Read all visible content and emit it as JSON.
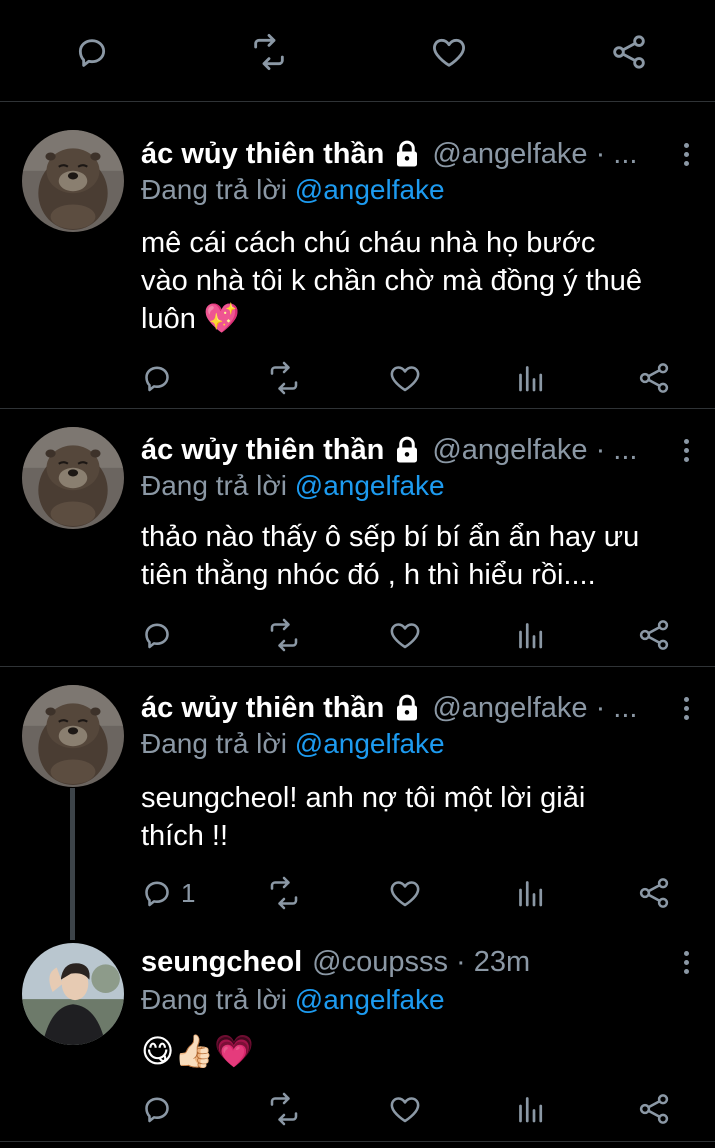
{
  "tweets": [
    {
      "name": "ác wủy thiên thần",
      "handle": "@angelfake · ...",
      "replying_prefix": "Đang trả lời",
      "replying_to": "@angelfake",
      "text_lines": [
        "mê cái cách chú cháu nhà họ bước",
        "vào nhà tôi k chần chờ mà đồng ý thuê",
        "luôn 💖"
      ]
    },
    {
      "name": "ác wủy thiên thần",
      "handle": "@angelfake · ...",
      "replying_prefix": "Đang trả lời",
      "replying_to": "@angelfake",
      "text_lines": [
        "thảo nào thấy ô sếp bí bí ẩn ẩn hay ưu",
        "tiên thằng nhóc đó , h thì hiểu rồi...."
      ]
    },
    {
      "name": "ác wủy thiên thần",
      "handle": "@angelfake · ...",
      "replying_prefix": "Đang trả lời",
      "replying_to": "@angelfake",
      "text_lines": [
        "seungcheol! anh nợ tôi một lời giải",
        "thích !!"
      ],
      "reply_count": "1"
    },
    {
      "name": "seungcheol",
      "handle": "@coupsss · 23m",
      "replying_prefix": "Đang trả lời",
      "replying_to": "@angelfake",
      "text_lines": [
        "😋👍🏻💗"
      ]
    }
  ],
  "icons": {
    "reply": "reply-icon",
    "retweet": "retweet-icon",
    "like": "heart-icon",
    "analytics": "analytics-icon",
    "share": "share-icon",
    "lock": "lock-icon",
    "more": "more-icon"
  },
  "colors": {
    "background": "#000000",
    "accent": "#1d9bf0",
    "muted": "#8b98a5",
    "divider": "#2f3336"
  }
}
